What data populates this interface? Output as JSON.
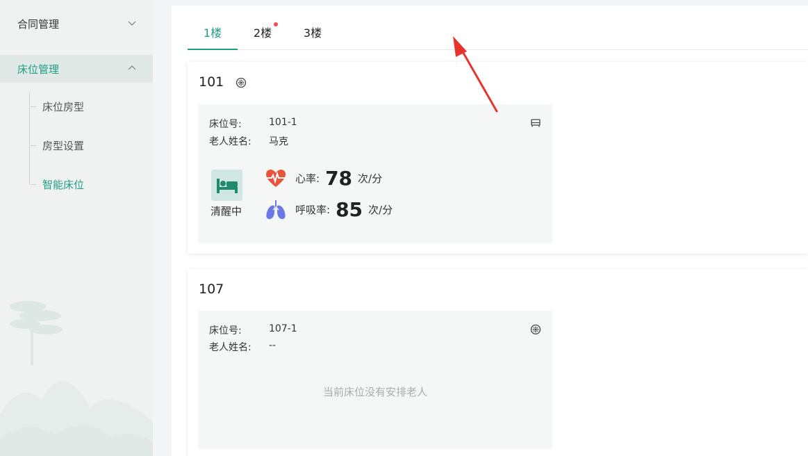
{
  "sidebar": {
    "items": [
      {
        "label": "合同管理"
      },
      {
        "label": "床位管理"
      }
    ],
    "subitems": [
      {
        "label": "床位房型"
      },
      {
        "label": "房型设置"
      },
      {
        "label": "智能床位"
      }
    ]
  },
  "tabs": [
    {
      "label": "1楼"
    },
    {
      "label": "2楼"
    },
    {
      "label": "3楼"
    }
  ],
  "rooms": [
    {
      "number": "101",
      "bed": {
        "bed_no_label": "床位号:",
        "bed_no": "101-1",
        "name_label": "老人姓名:",
        "name": "马克",
        "status": "清醒中",
        "heart_label": "心率:",
        "heart_value": "78",
        "heart_unit": "次/分",
        "resp_label": "呼吸率:",
        "resp_value": "85",
        "resp_unit": "次/分"
      }
    },
    {
      "number": "107",
      "bed": {
        "bed_no_label": "床位号:",
        "bed_no": "107-1",
        "name_label": "老人姓名:",
        "name": "--",
        "empty_text": "当前床位没有安排老人"
      }
    }
  ],
  "colors": {
    "accent": "#1f9d85",
    "badge": "#f24d4d",
    "annotation_arrow": "#e8332e",
    "heart": "#e8553c",
    "lungs": "#6b79e8"
  }
}
